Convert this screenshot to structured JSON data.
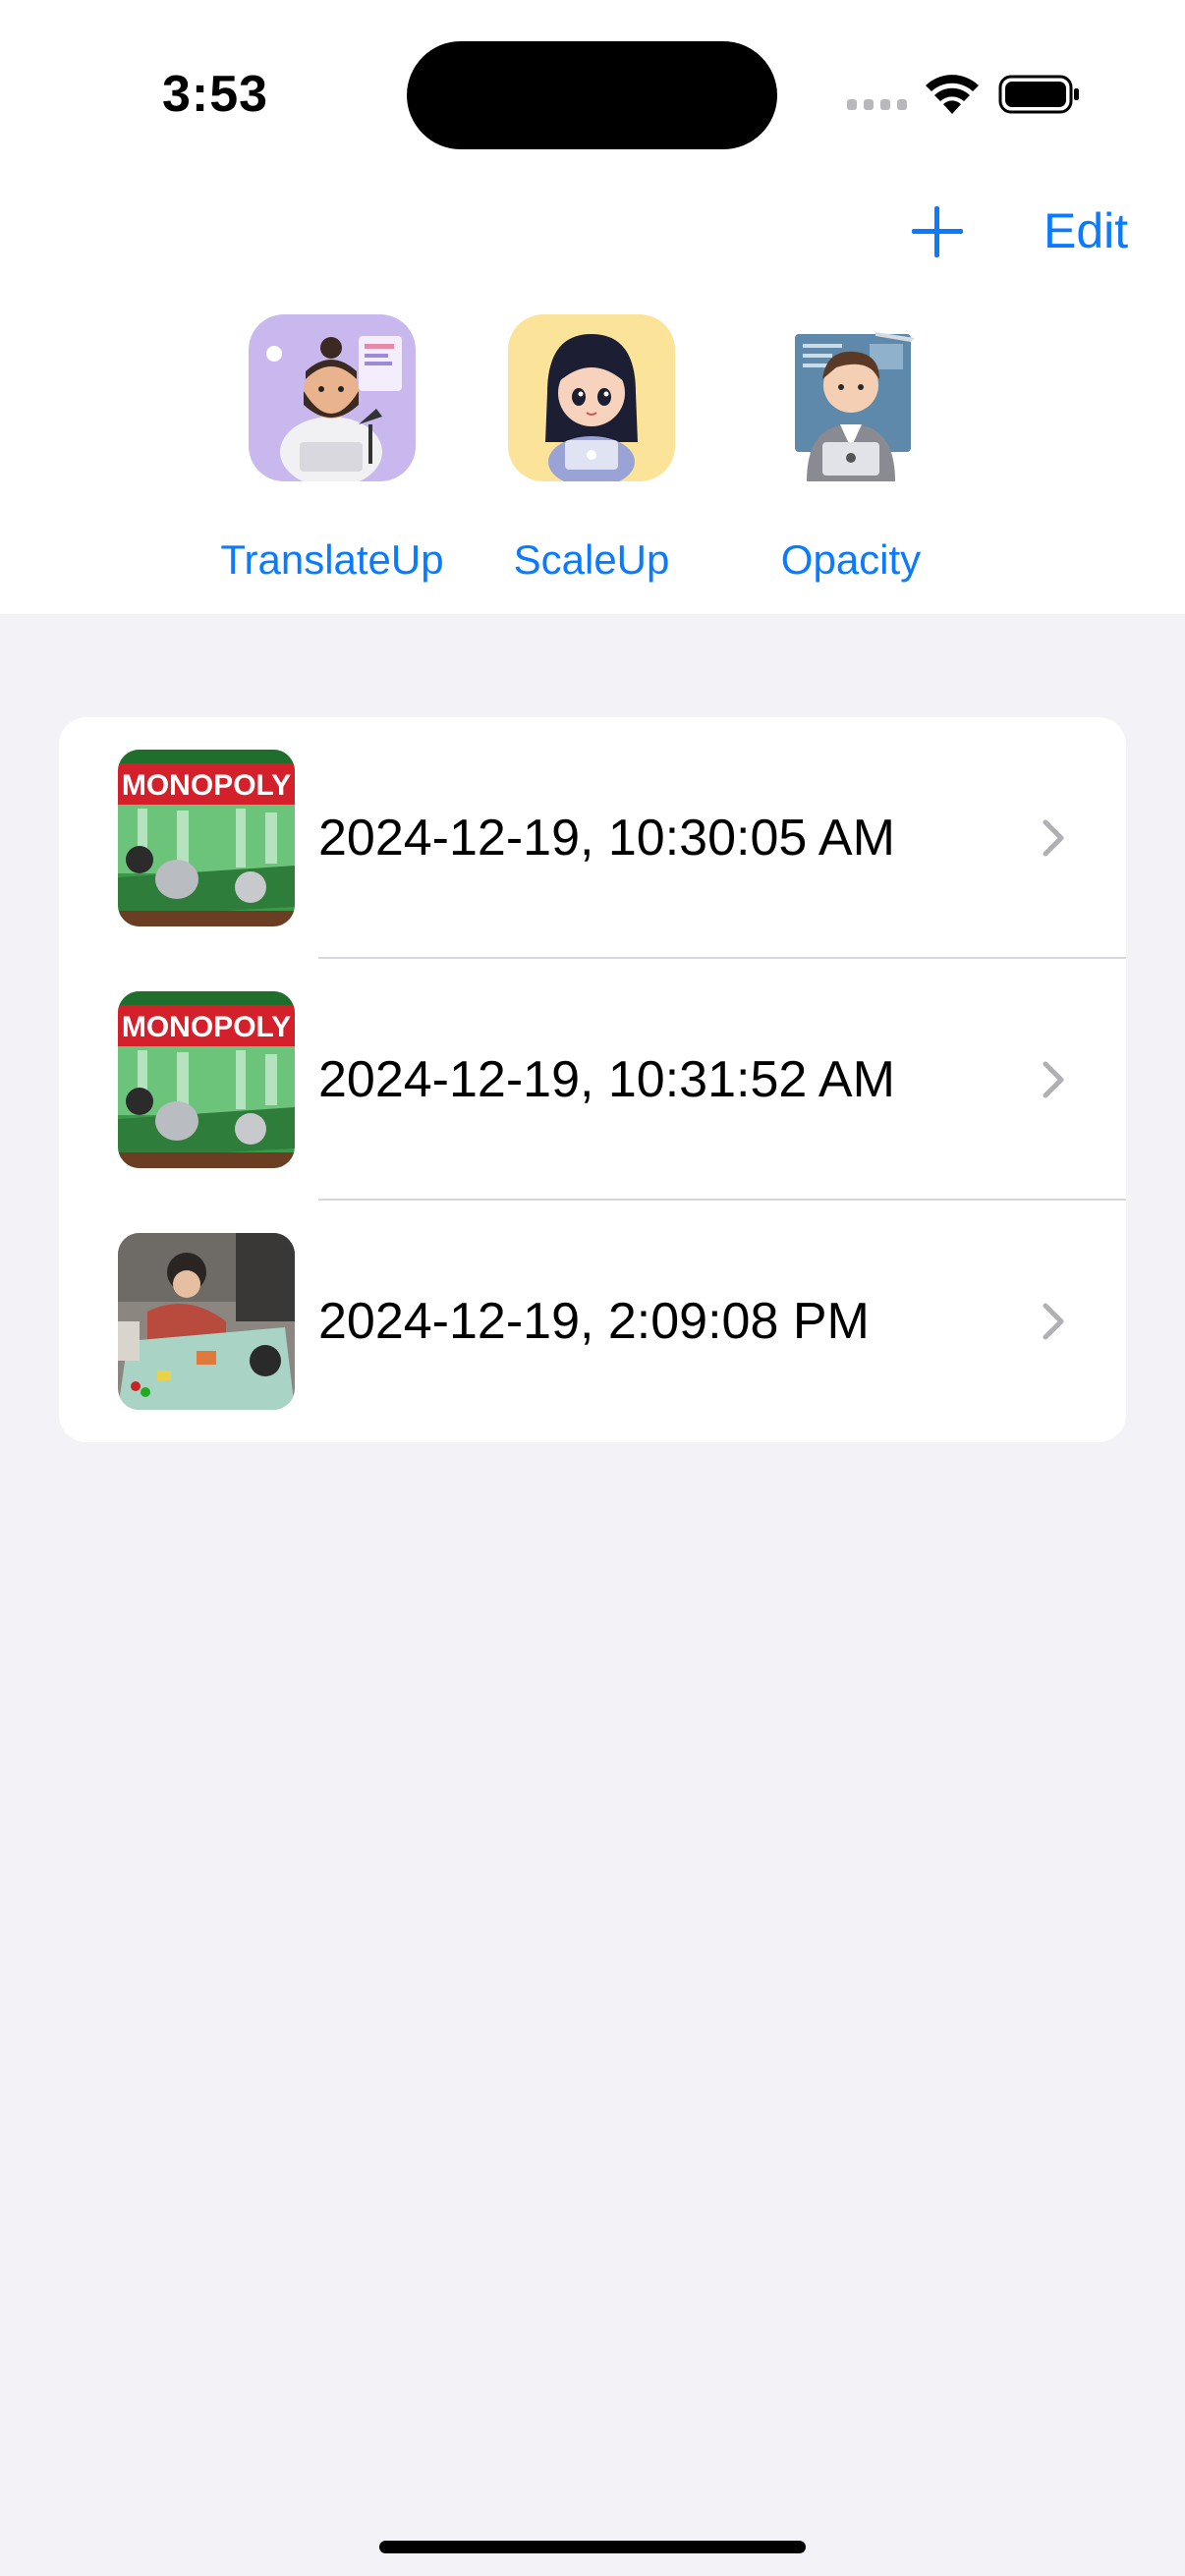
{
  "status_bar": {
    "time": "3:53",
    "icons": [
      "cellular-signal-icon",
      "wifi-icon",
      "battery-icon"
    ]
  },
  "nav": {
    "add_icon": "plus-icon",
    "edit_label": "Edit",
    "accent_color": "#0a7aff"
  },
  "stickers": [
    {
      "label": "TranslateUp",
      "icon": "developer-man-avatar"
    },
    {
      "label": "ScaleUp",
      "icon": "developer-woman-avatar"
    },
    {
      "label": "Opacity",
      "icon": "developer-boy-avatar"
    }
  ],
  "list": {
    "items": [
      {
        "title": "2024-12-19, 10:30:05 AM",
        "thumb": "monopoly-box-photo"
      },
      {
        "title": "2024-12-19, 10:31:52 AM",
        "thumb": "monopoly-box-photo"
      },
      {
        "title": "2024-12-19, 2:09:08 PM",
        "thumb": "people-playing-board-game-photo"
      }
    ]
  }
}
